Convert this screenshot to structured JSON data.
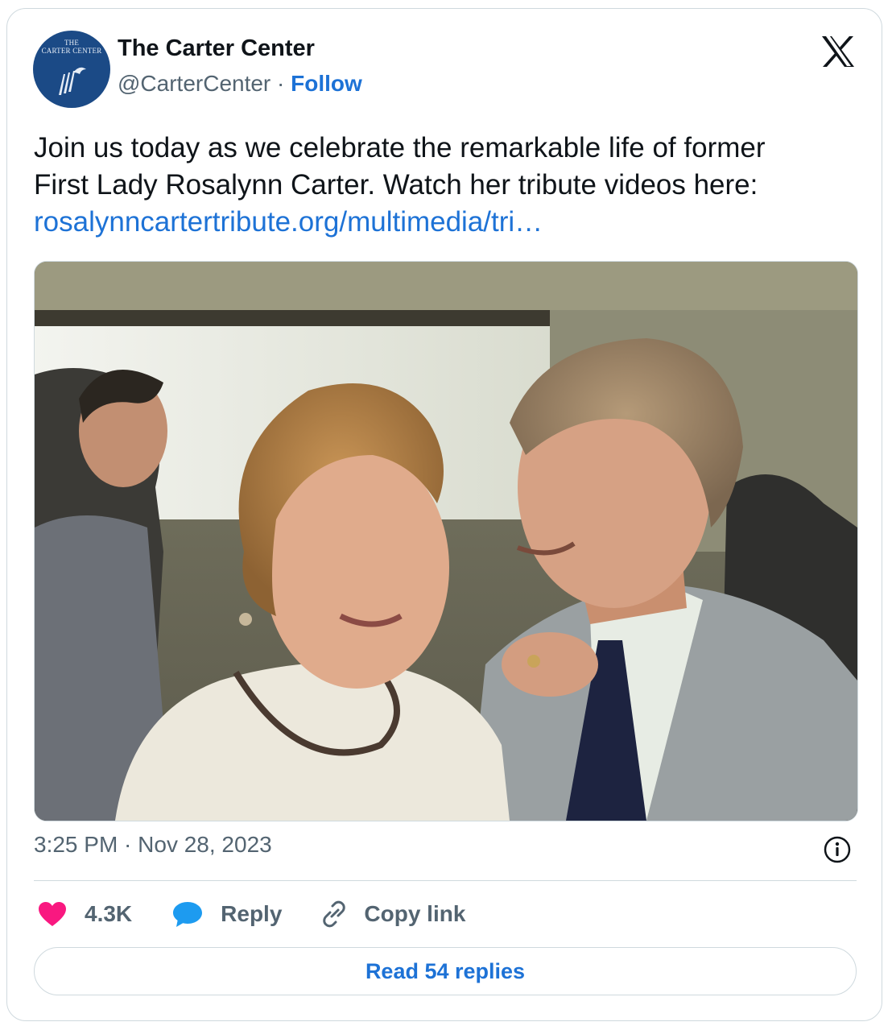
{
  "account": {
    "avatar_logo_text_line1": "THE",
    "avatar_logo_text_line2": "CARTER CENTER",
    "name": "The Carter Center",
    "handle": "@CarterCenter",
    "separator": " · ",
    "follow_label": "Follow"
  },
  "platform_icon": "x-logo-icon",
  "tweet": {
    "text_line1": "Join us today as we celebrate the remarkable life of former",
    "text_line2": "First Lady Rosalynn Carter. Watch her tribute videos here:",
    "link_text": "rosalynncartertribute.org/multimedia/tri…"
  },
  "media": {
    "icon": "photo-image"
  },
  "timestamp": "3:25 PM · Nov 28, 2023",
  "actions": {
    "like_count": "4.3K",
    "like_icon": "heart-icon",
    "reply_label": "Reply",
    "reply_icon": "speech-bubble-icon",
    "copy_label": "Copy link",
    "copy_icon": "link-icon"
  },
  "read_replies_label": "Read 54 replies",
  "colors": {
    "link": "#1d72d6",
    "secondary_text": "#536471",
    "like": "#f91880",
    "reply": "#1d9bf0",
    "border": "#cfd9de"
  }
}
